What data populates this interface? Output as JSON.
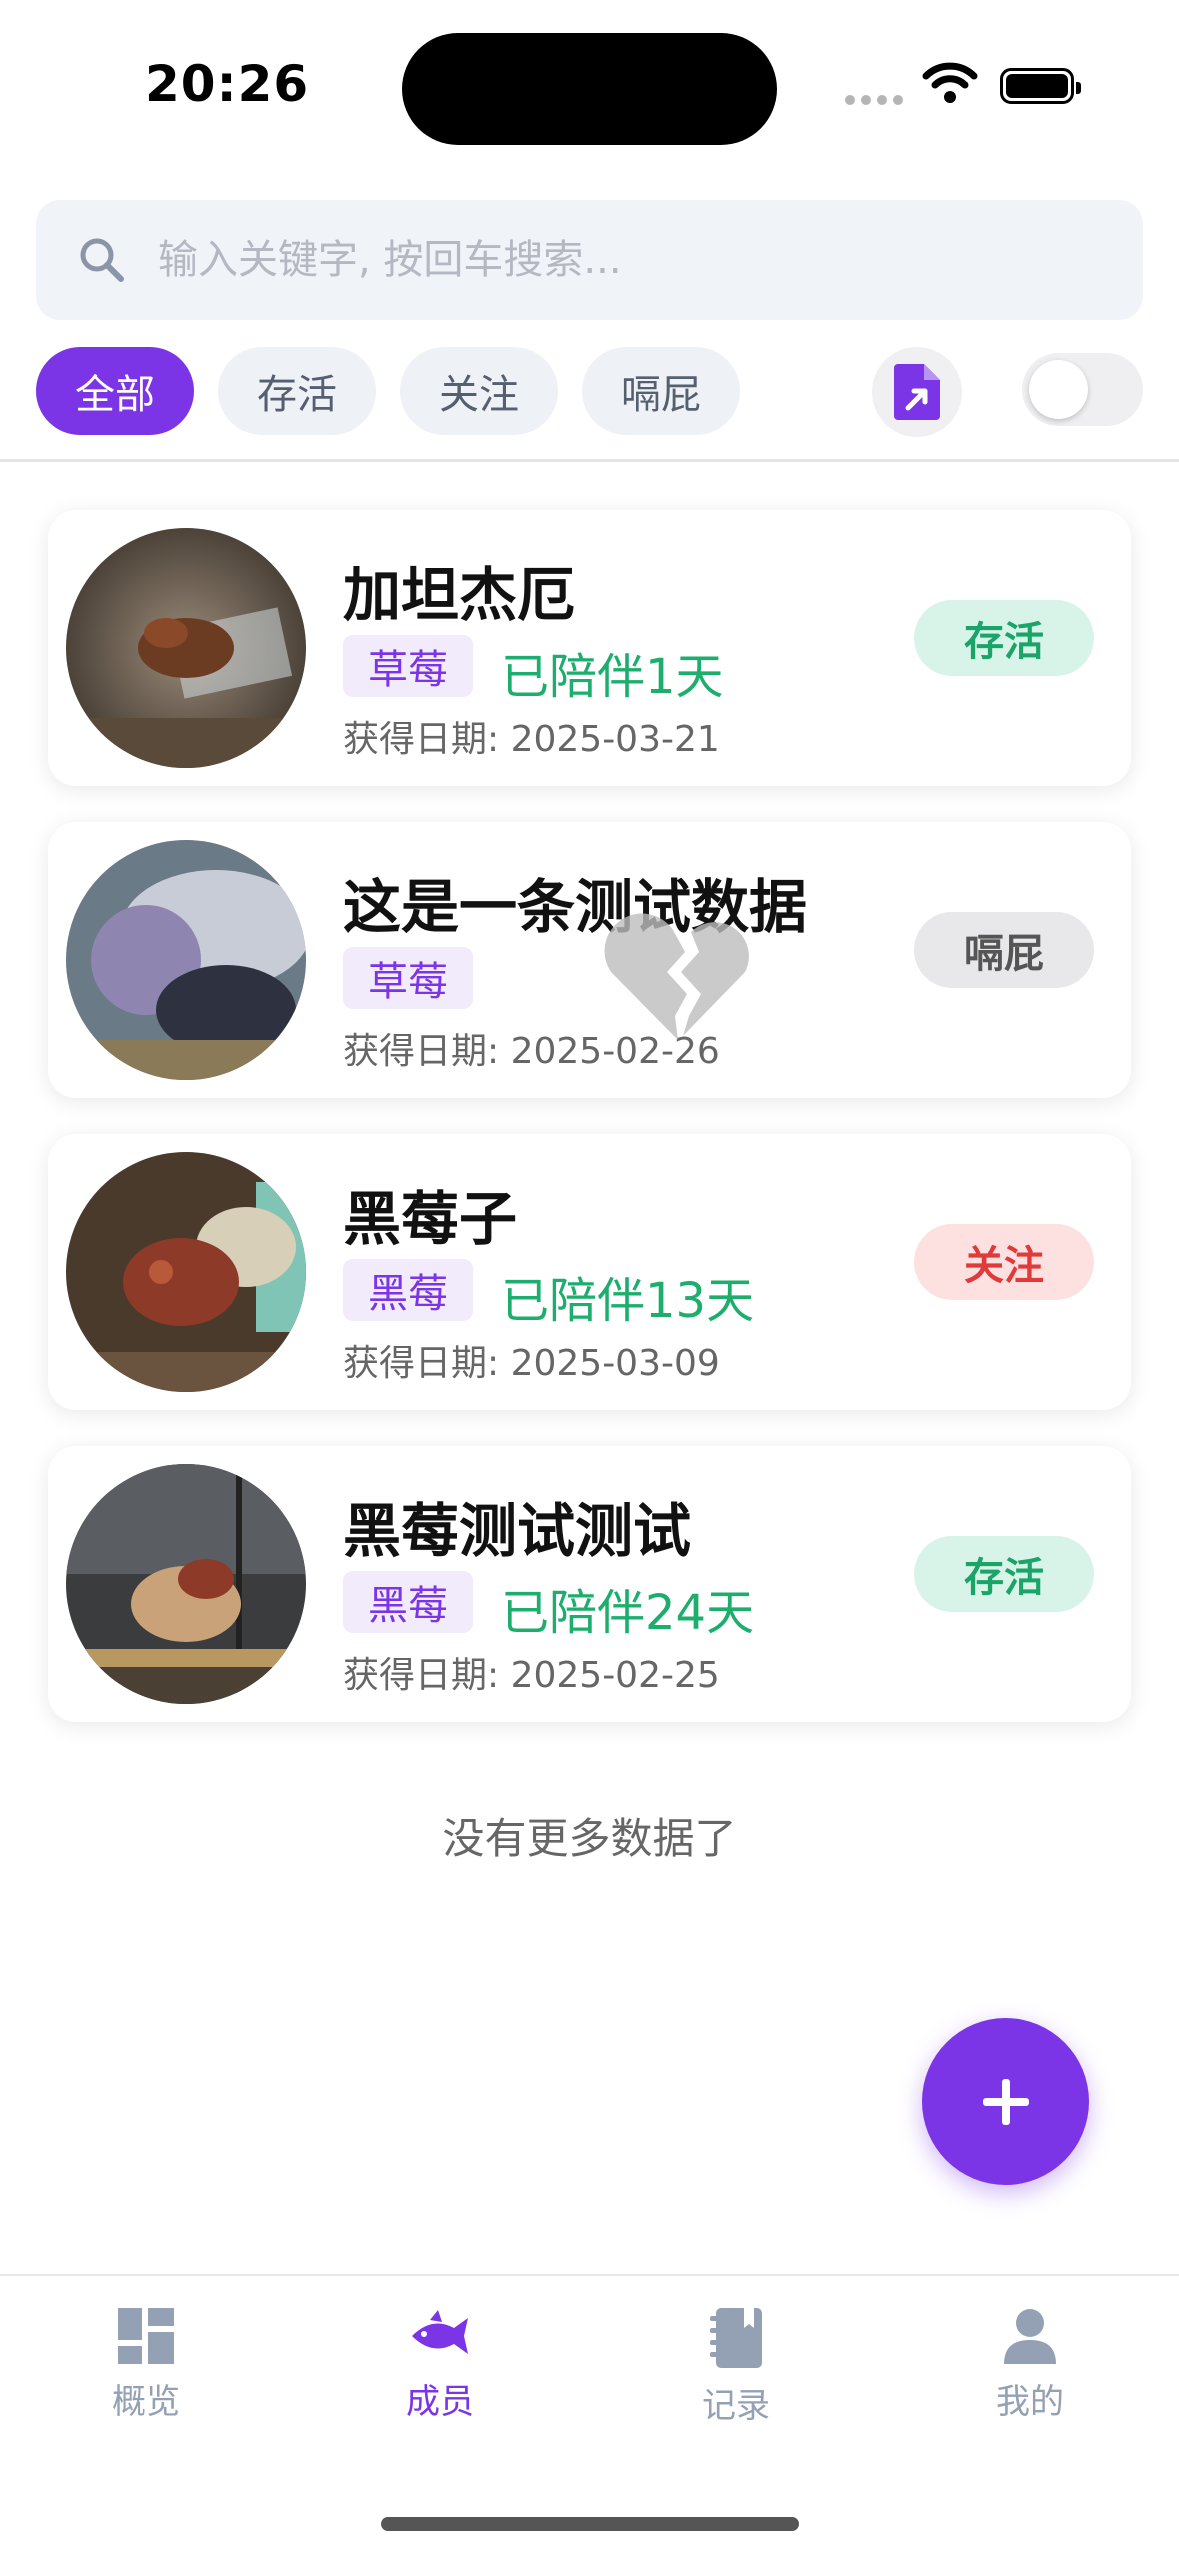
{
  "status_bar": {
    "time": "20:26"
  },
  "search": {
    "placeholder": "输入关键字, 按回车搜索...",
    "value": ""
  },
  "filters": [
    {
      "label": "全部",
      "active": true
    },
    {
      "label": "存活",
      "active": false
    },
    {
      "label": "关注",
      "active": false
    },
    {
      "label": "嗝屁",
      "active": false
    }
  ],
  "toggle": {
    "on": false
  },
  "cards": [
    {
      "name": "加坦杰厄",
      "species": "草莓",
      "days": "已陪伴1天",
      "acquired": "获得日期: 2025-03-21",
      "status": "存活"
    },
    {
      "name": "这是一条测试数据",
      "species": "草莓",
      "days": "",
      "acquired": "获得日期: 2025-02-26",
      "status": "嗝屁"
    },
    {
      "name": "黑莓子",
      "species": "黑莓",
      "days": "已陪伴13天",
      "acquired": "获得日期: 2025-03-09",
      "status": "关注"
    },
    {
      "name": "黑莓测试测试",
      "species": "黑莓",
      "days": "已陪伴24天",
      "acquired": "获得日期: 2025-02-25",
      "status": "存活"
    }
  ],
  "footer_text": "没有更多数据了",
  "tabs": [
    {
      "label": "概览",
      "icon": "dashboard-icon",
      "active": false
    },
    {
      "label": "成员",
      "icon": "fish-icon",
      "active": true
    },
    {
      "label": "记录",
      "icon": "notebook-icon",
      "active": false
    },
    {
      "label": "我的",
      "icon": "person-icon",
      "active": false
    }
  ],
  "colors": {
    "accent": "#7b35e6",
    "alive": "#1aa46a",
    "watch": "#e03a3a",
    "days_green": "#1dae6e"
  }
}
